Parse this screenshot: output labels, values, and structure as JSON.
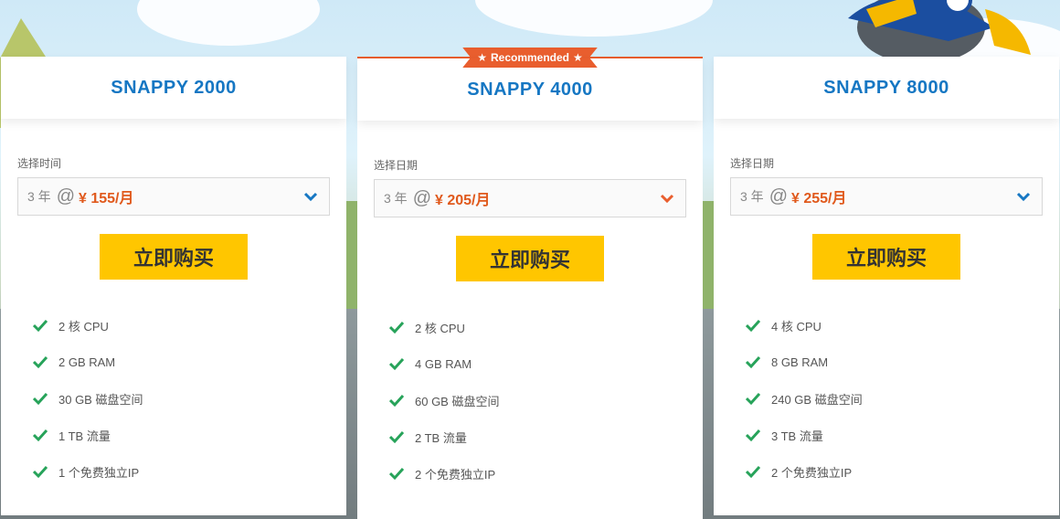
{
  "colors": {
    "accent_blue": "#1677c3",
    "price_orange": "#e0591c",
    "buy_yellow": "#ffc600",
    "ribbon_orange": "#e95e2e",
    "check_green": "#27a35a"
  },
  "plans": [
    {
      "name": "SNAPPY 2000",
      "period_label": "选择时间",
      "years": "3 年",
      "at": "@",
      "price": "¥ 155/月",
      "buy_label": "立即购买",
      "features": [
        "2 核 CPU",
        "2 GB RAM",
        "30 GB 磁盘空间",
        "1 TB 流量",
        "1 个免费独立IP"
      ]
    },
    {
      "name": "SNAPPY 4000",
      "badge": "Recommended",
      "period_label": "选择日期",
      "years": "3 年",
      "at": "@",
      "price": "¥ 205/月",
      "buy_label": "立即购买",
      "features": [
        "2 核 CPU",
        "4 GB RAM",
        "60 GB 磁盘空间",
        "2 TB 流量",
        "2 个免费独立IP"
      ]
    },
    {
      "name": "SNAPPY 8000",
      "period_label": "选择日期",
      "years": "3 年",
      "at": "@",
      "price": "¥ 255/月",
      "buy_label": "立即购买",
      "features": [
        "4 核 CPU",
        "8 GB RAM",
        "240 GB 磁盘空间",
        "3 TB 流量",
        "2 个免费独立IP"
      ]
    }
  ]
}
